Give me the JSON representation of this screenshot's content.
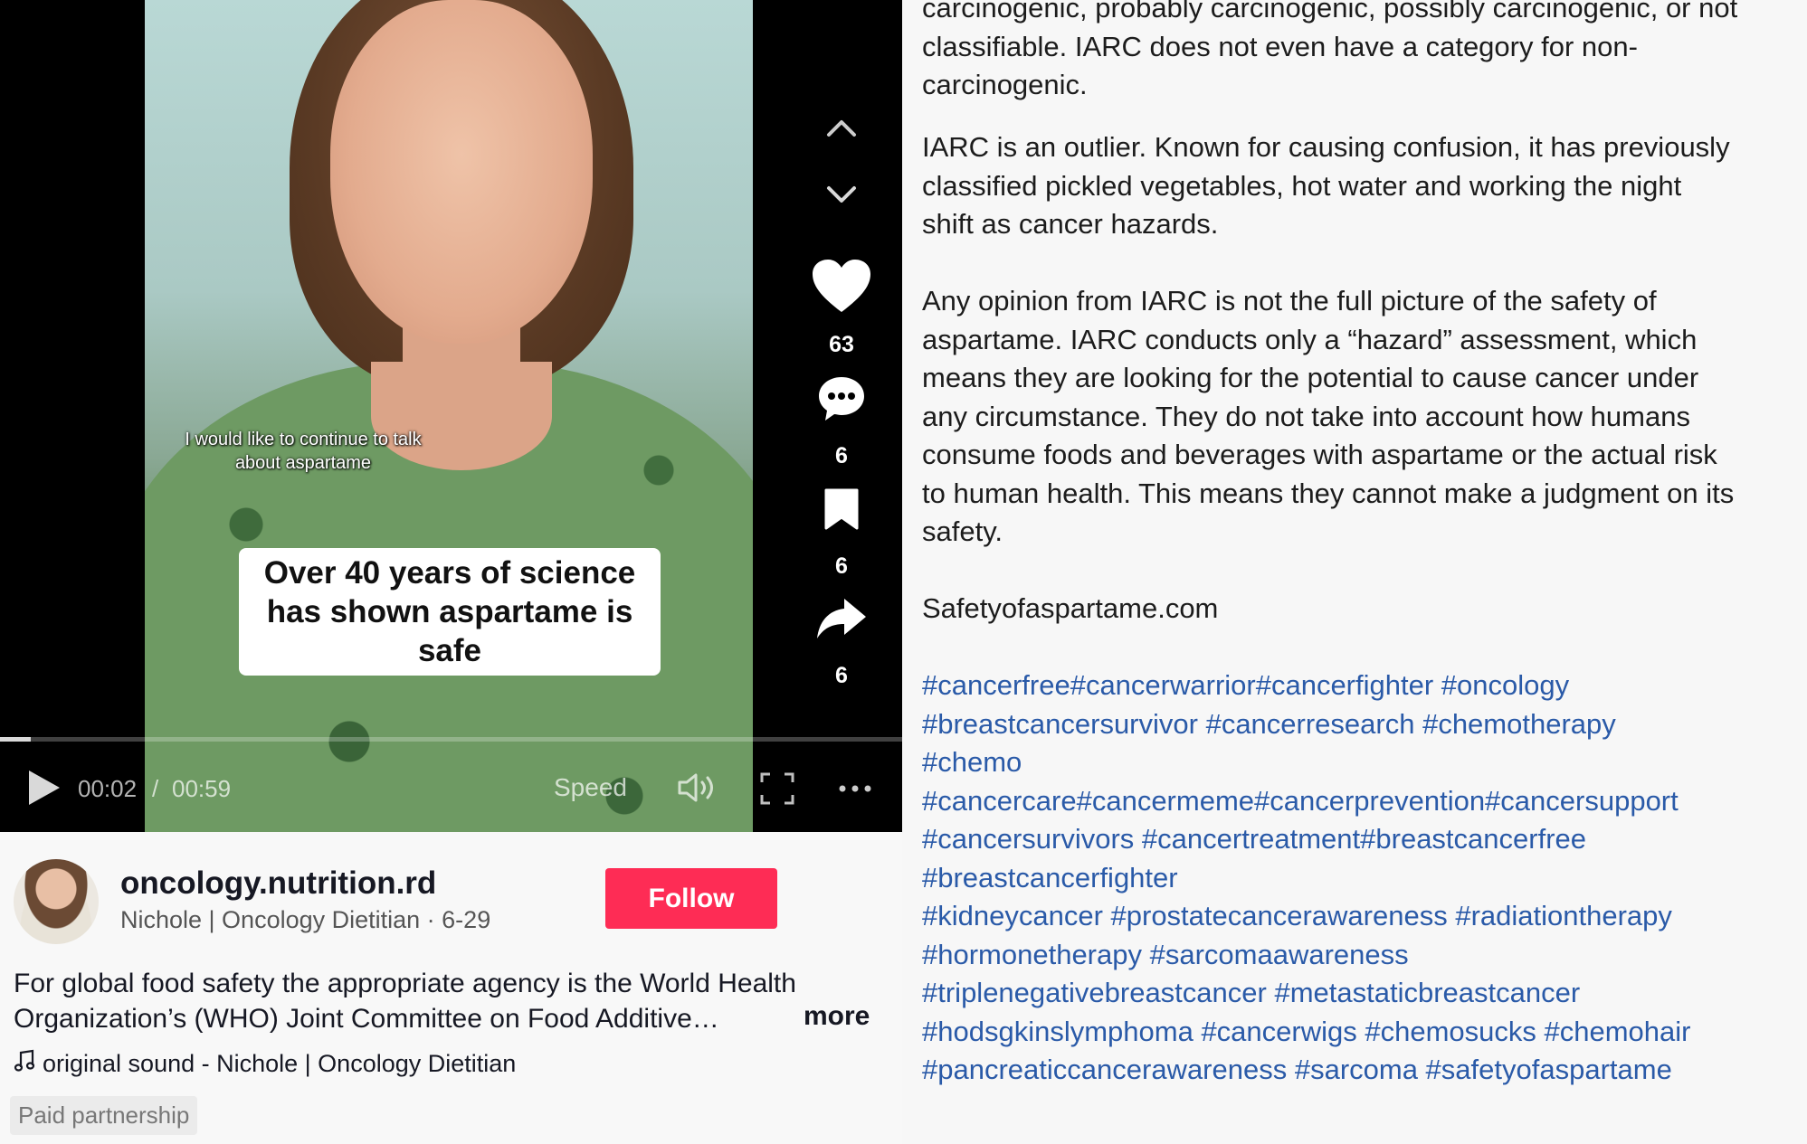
{
  "video": {
    "caption_small": "I would like to continue to talk about aspartame",
    "caption_main_line1": "Over 40 years of science",
    "caption_main_line2": "has shown aspartame is",
    "caption_main_line3": "safe",
    "time_current": "00:02",
    "time_separator": "/",
    "time_total": "00:59",
    "speed_label": "Speed",
    "progress_fraction": 0.034,
    "icons": [
      "play-icon",
      "volume-icon",
      "fullscreen-icon",
      "more-icon"
    ]
  },
  "rail": {
    "like_count": "63",
    "comment_count": "6",
    "bookmark_count": "6",
    "share_count": "6",
    "icons": [
      "arrow-up-icon",
      "arrow-down-icon",
      "heart-icon",
      "comment-icon",
      "bookmark-icon",
      "share-icon"
    ]
  },
  "author": {
    "username": "oncology.nutrition.rd",
    "subtitle": "Nichole | Oncology Dietitian · 6-29",
    "follow_label": "Follow"
  },
  "post": {
    "description_line1": "For global food safety the appropriate agency is the World Health",
    "description_line2": "Organization’s (WHO) Joint Committee on Food Additive…",
    "more_label": "more",
    "music_icon": "music-note-icon",
    "sound": "original sound - Nichole | Oncology Dietitian",
    "paid_label": "Paid partnership"
  },
  "article": {
    "para1_line1": "carcinogenic, probably carcinogenic, possibly carcinogenic, or not",
    "para1_line2": "classifiable. IARC does not even have a category for non-",
    "para1_line3": "carcinogenic.",
    "para2_line1": "IARC is an outlier. Known for causing confusion, it has previously",
    "para2_line2": "classified pickled vegetables, hot water and working the night",
    "para2_line3": "shift as cancer hazards.",
    "para3_line1": "Any opinion from IARC is not the full picture of the safety of",
    "para3_line2": "aspartame. IARC conducts only a “hazard” assessment, which",
    "para3_line3": "means they are looking for the potential to cause cancer under",
    "para3_line4": "any circumstance. They do not take into account how humans",
    "para3_line5": "consume foods and beverages with aspartame or the actual risk",
    "para3_line6": "to human health. This means they cannot make a judgment on its",
    "para3_line7": "safety.",
    "website": "Safetyofaspartame.com",
    "hashtag_lines": [
      " #cancerfree#cancerwarrior#cancerfighter #oncology",
      "#breastcancersurvivor #cancerresearch #chemotherapy",
      "#chemo",
      "#cancercare#cancermeme#cancerprevention#cancersupport",
      "#cancersurvivors #cancertreatment#breastcancerfree",
      "#breastcancerfighter",
      " #kidneycancer #prostatecancerawareness #radiationtherapy",
      "#hormonetherapy #sarcomaawareness",
      "#triplenegativebreastcancer #metastaticbreastcancer",
      "#hodsgkinslymphoma #cancerwigs #chemosucks #chemohair",
      "#pancreaticcancerawareness #sarcoma #safetyofaspartame"
    ]
  },
  "colors": {
    "follow_button": "#fe2c55",
    "hashtag": "#2a5aa8",
    "player_bg": "#000000"
  }
}
